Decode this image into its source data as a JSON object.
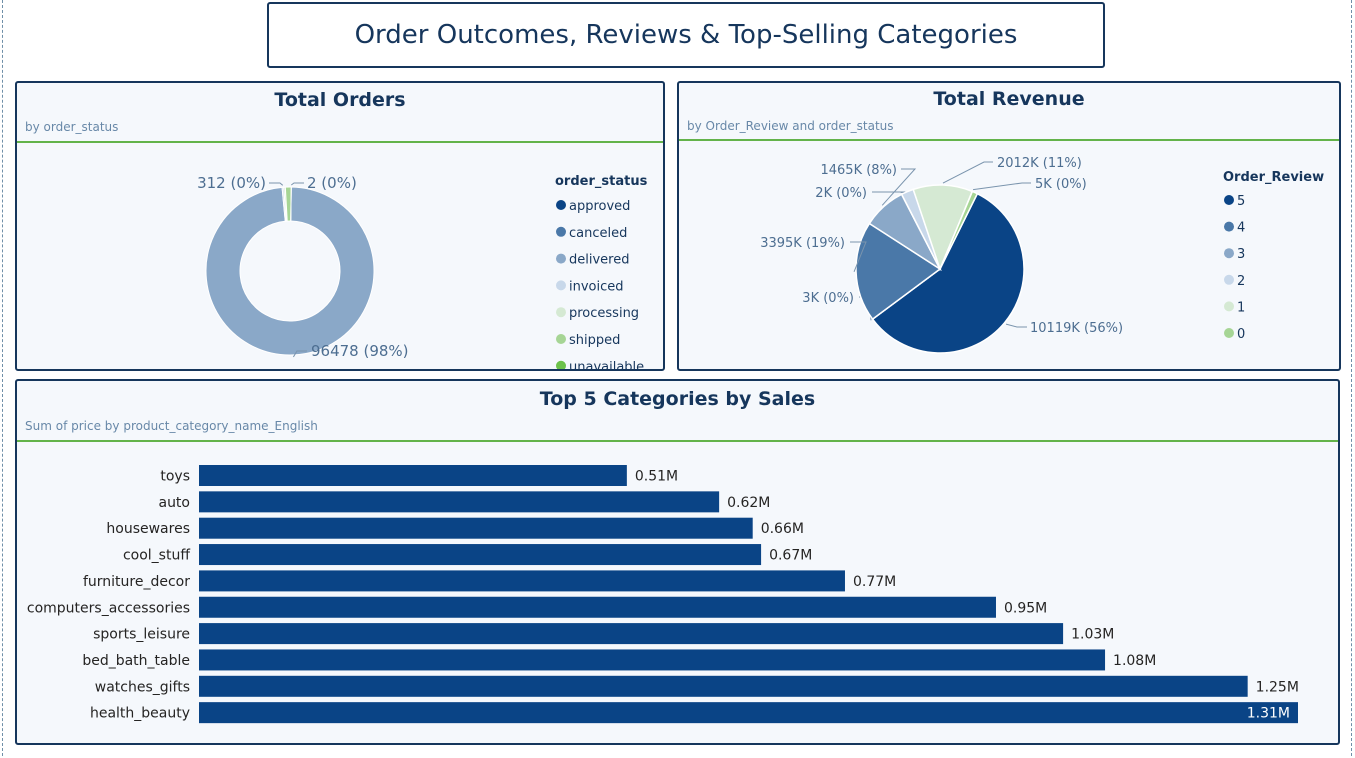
{
  "page": {
    "title": "Order Outcomes, Reviews & Top-Selling Categories"
  },
  "colors": {
    "navy": "#16365c",
    "accent_rule": "#63b34a",
    "bar": "#0a4486",
    "status": {
      "approved": "#0a4486",
      "canceled": "#4a78a8",
      "delivered": "#8aa8c8",
      "invoiced": "#c8d8ea",
      "processing": "#d5e9d3",
      "shipped": "#a6d595",
      "unavailable": "#6cc24a"
    },
    "review": {
      "5": "#0a4486",
      "4": "#4a78a8",
      "3": "#8aa8c8",
      "2": "#c8d8ea",
      "1": "#d5e9d3",
      "0": "#a6d595"
    }
  },
  "orders_card": {
    "title": "Total Orders",
    "subtitle": "by order_status",
    "legend_title": "order_status"
  },
  "revenue_card": {
    "title": "Total Revenue",
    "subtitle": "by Order_Review and order_status",
    "legend_title": "Order_Review"
  },
  "sales_card": {
    "title": "Top 5 Categories by Sales",
    "subtitle": "Sum of price by product_category_name_English"
  },
  "chart_data": [
    {
      "type": "pie",
      "title": "Total Orders",
      "subtitle": "by order_status",
      "donut": true,
      "legend_title": "order_status",
      "legend_position": "right",
      "slices": [
        {
          "name": "approved",
          "value": 2,
          "label": ""
        },
        {
          "name": "canceled",
          "value": 0,
          "label": ""
        },
        {
          "name": "delivered",
          "value": 96478,
          "label": "96478 (98%)"
        },
        {
          "name": "invoiced",
          "value": 312,
          "label": "312 (0%)"
        },
        {
          "name": "processing",
          "value": 300,
          "label": ""
        },
        {
          "name": "shipped",
          "value": 1100,
          "label": ""
        },
        {
          "name": "unavailable",
          "value": 2,
          "label": "2 (0%)"
        }
      ]
    },
    {
      "type": "pie",
      "title": "Total Revenue",
      "subtitle": "by Order_Review and order_status",
      "donut": false,
      "legend_title": "Order_Review",
      "legend_position": "right",
      "slices": [
        {
          "name": "5",
          "value": 10119,
          "label": "10119K (56%)"
        },
        {
          "name": "0",
          "value": 3,
          "label": "3K (0%)"
        },
        {
          "name": "4",
          "value": 3395,
          "label": "3395K (19%)"
        },
        {
          "name": "3",
          "value": 1465,
          "label": "1465K (8%)"
        },
        {
          "name": "2",
          "value": 2,
          "label": "2K (0%)"
        },
        {
          "name": "2",
          "value": 420,
          "label": ""
        },
        {
          "name": "1",
          "value": 2012,
          "label": "2012K (11%)"
        },
        {
          "name": "0",
          "value": 5,
          "label": "5K (0%)"
        },
        {
          "name": "0",
          "value": 180,
          "label": ""
        }
      ]
    },
    {
      "type": "bar",
      "orientation": "horizontal",
      "title": "Top 5 Categories by Sales",
      "subtitle": "Sum of price by product_category_name_English",
      "categories": [
        "toys",
        "auto",
        "housewares",
        "cool_stuff",
        "furniture_decor",
        "computers_accessories",
        "sports_leisure",
        "bed_bath_table",
        "watches_gifts",
        "health_beauty"
      ],
      "values": [
        0.51,
        0.62,
        0.66,
        0.67,
        0.77,
        0.95,
        1.03,
        1.08,
        1.25,
        1.31
      ],
      "value_labels": [
        "0.51M",
        "0.62M",
        "0.66M",
        "0.67M",
        "0.77M",
        "0.95M",
        "1.03M",
        "1.08M",
        "1.25M",
        "1.31M"
      ],
      "xlim": [
        0,
        1.31
      ],
      "grid": false
    }
  ]
}
